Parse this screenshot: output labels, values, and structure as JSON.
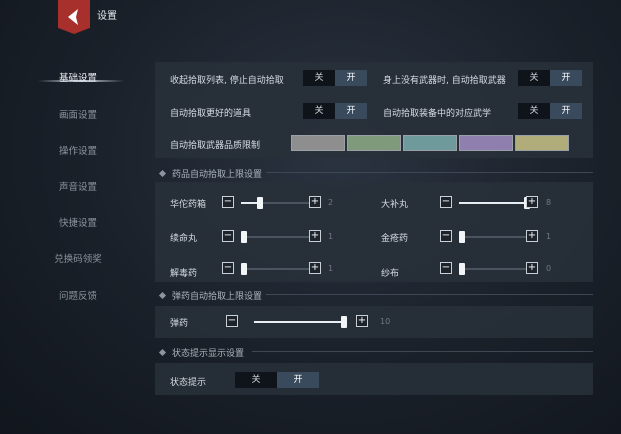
{
  "header": {
    "title": "设置"
  },
  "sidebar": {
    "items": [
      {
        "label": "基础设置",
        "active": true
      },
      {
        "label": "画面设置"
      },
      {
        "label": "操作设置"
      },
      {
        "label": "声音设置"
      },
      {
        "label": "快捷设置"
      },
      {
        "label": "兑换码领奖"
      },
      {
        "label": "问题反馈"
      }
    ]
  },
  "basic": {
    "row1_left_label": "收起拾取列表, 停止自动拾取",
    "row1_right_label": "身上没有武器时, 自动拾取武器",
    "row2_left_label": "自动拾取更好的道具",
    "row2_right_label": "自动拾取装备中的对应武学",
    "toggle_off": "关",
    "toggle_on": "开",
    "quality_label": "自动拾取武器品质限制",
    "quality_colors": [
      "#8e8e8e",
      "#7f9a7a",
      "#6f9a9c",
      "#8f7fae",
      "#b1ad7a"
    ]
  },
  "medicine": {
    "section_title": "药品自动拾取上限设置",
    "minus": "−",
    "plus": "+",
    "items": [
      {
        "label": "华佗药箱",
        "value": "2",
        "level": 0.25
      },
      {
        "label": "大补丸",
        "value": "8",
        "level": 1.0
      },
      {
        "label": "续命丸",
        "value": "1",
        "level": 0.0
      },
      {
        "label": "金疮药",
        "value": "1",
        "level": 0.0
      },
      {
        "label": "解毒药",
        "value": "1",
        "level": 0.0
      },
      {
        "label": "纱布",
        "value": "0",
        "level": 0.0
      }
    ]
  },
  "ammo": {
    "section_title": "弹药自动拾取上限设置",
    "label": "弹药",
    "value": "10",
    "level": 1.0
  },
  "status": {
    "section_title": "状态提示显示设置",
    "label": "状态提示",
    "toggle_off": "关",
    "toggle_on": "开"
  }
}
